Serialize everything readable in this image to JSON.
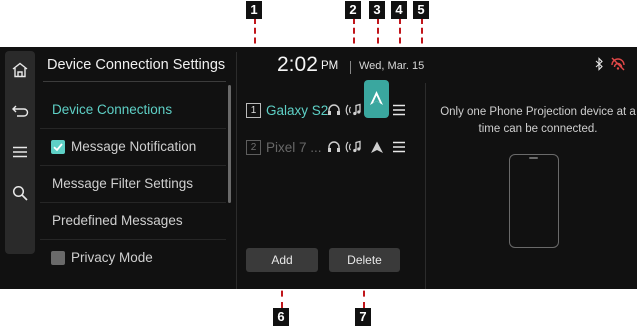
{
  "callouts": {
    "c1": "1",
    "c2": "2",
    "c3": "3",
    "c4": "4",
    "c5": "5",
    "c6": "6",
    "c7": "7"
  },
  "rail": {
    "icons": [
      "home-icon",
      "back-icon",
      "menu-icon",
      "search-icon"
    ]
  },
  "header": {
    "title": "Device Connection Settings",
    "time": "2:02",
    "ampm": "PM",
    "date": "Wed, Mar. 15"
  },
  "status_icons": [
    "bluetooth-icon",
    "signal-off-icon"
  ],
  "menu": {
    "items": [
      {
        "label": "Device Connections",
        "state": "active"
      },
      {
        "label": "Message Notification",
        "checked": true
      },
      {
        "label": "Message Filter Settings"
      },
      {
        "label": "Predefined Messages"
      },
      {
        "label": "Privacy Mode",
        "checked": false
      }
    ]
  },
  "devices": [
    {
      "num": "1",
      "name": "Galaxy S2",
      "connected": true
    },
    {
      "num": "2",
      "name": "Pixel 7 ...",
      "connected": false
    }
  ],
  "buttons": {
    "add": "Add",
    "delete": "Delete"
  },
  "info": {
    "line1": "Only one Phone Projection device at a",
    "line2": "time can be connected."
  },
  "colors": {
    "accent": "#5ed0c6",
    "active_icon_bg": "#3aa79f",
    "screen_bg": "#111111",
    "callout_line": "#c0161b"
  }
}
